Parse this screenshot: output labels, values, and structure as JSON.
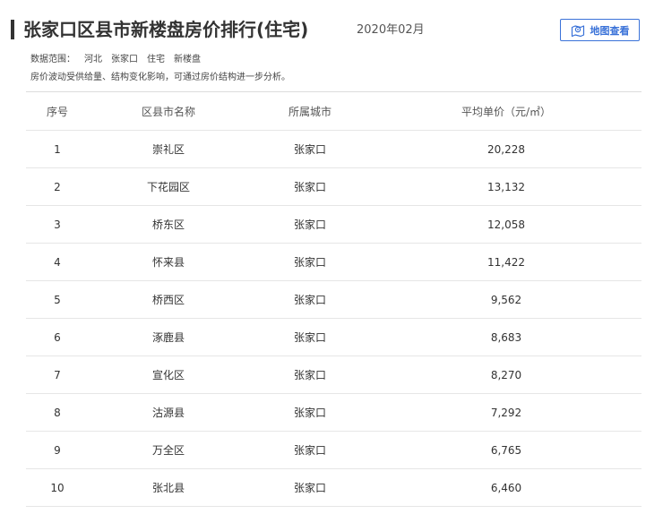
{
  "header": {
    "title": "张家口区县市新楼盘房价排行(住宅)",
    "date": "2020年02月",
    "map_button_label": "地图查看",
    "map_icon": "map-pin-icon"
  },
  "meta": {
    "scope_label": "数据范围：",
    "scope_items": [
      "河北",
      "张家口",
      "住宅",
      "新楼盘"
    ],
    "note": "房价波动受供给量、结构变化影响，可通过房价结构进一步分析。"
  },
  "table": {
    "headers": [
      "序号",
      "区县市名称",
      "所属城市",
      "平均单价（元/㎡）"
    ],
    "rows": [
      {
        "rank": "1",
        "name": "崇礼区",
        "city": "张家口",
        "price": "20,228"
      },
      {
        "rank": "2",
        "name": "下花园区",
        "city": "张家口",
        "price": "13,132"
      },
      {
        "rank": "3",
        "name": "桥东区",
        "city": "张家口",
        "price": "12,058"
      },
      {
        "rank": "4",
        "name": "怀来县",
        "city": "张家口",
        "price": "11,422"
      },
      {
        "rank": "5",
        "name": "桥西区",
        "city": "张家口",
        "price": "9,562"
      },
      {
        "rank": "6",
        "name": "涿鹿县",
        "city": "张家口",
        "price": "8,683"
      },
      {
        "rank": "7",
        "name": "宣化区",
        "city": "张家口",
        "price": "8,270"
      },
      {
        "rank": "8",
        "name": "沽源县",
        "city": "张家口",
        "price": "7,292"
      },
      {
        "rank": "9",
        "name": "万全区",
        "city": "张家口",
        "price": "6,765"
      },
      {
        "rank": "10",
        "name": "张北县",
        "city": "张家口",
        "price": "6,460"
      }
    ]
  },
  "colors": {
    "accent": "#3a72d8",
    "text": "#333333",
    "divider": "#e6e6e6"
  }
}
